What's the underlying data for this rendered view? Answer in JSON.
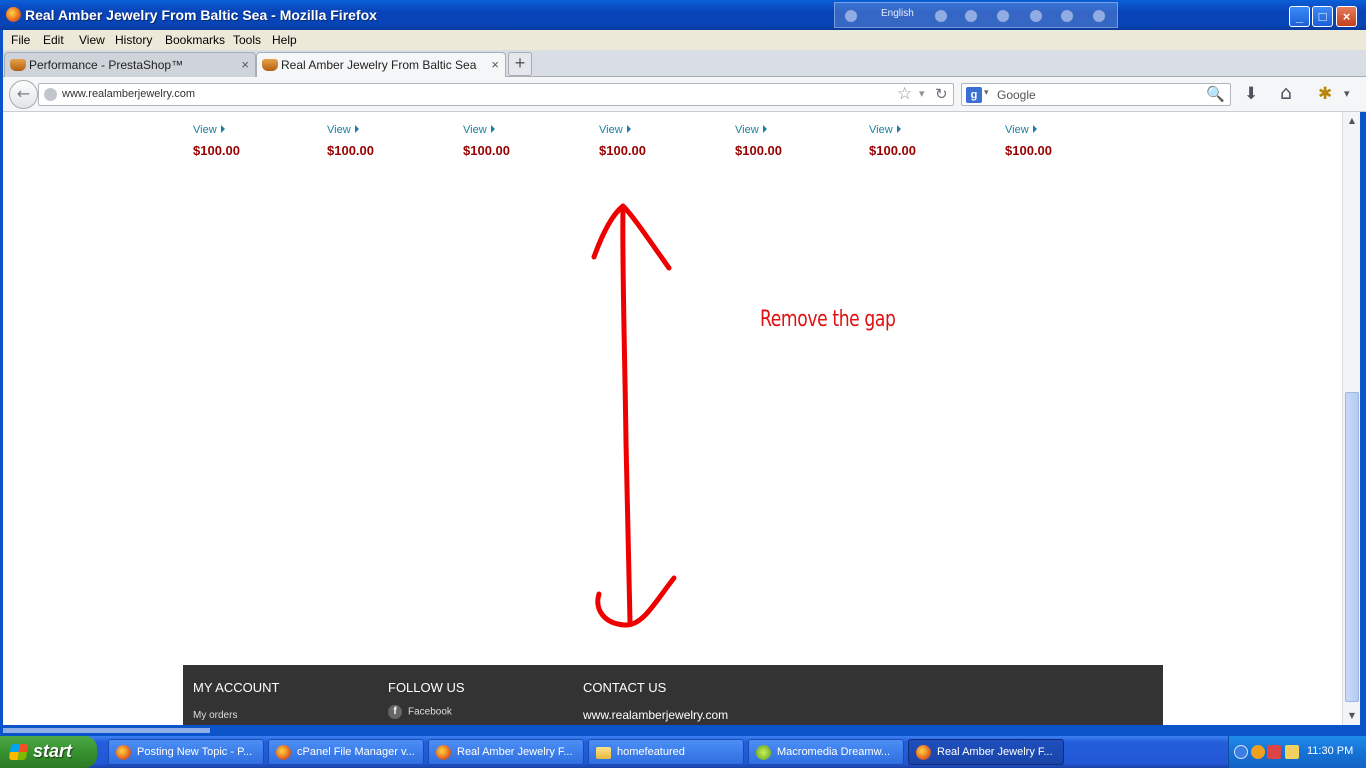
{
  "window": {
    "title": "Real Amber Jewelry From Baltic Sea - Mozilla Firefox",
    "language": "English",
    "minimize": "_",
    "maximize": "□",
    "close": "×"
  },
  "menu": [
    "File",
    "Edit",
    "View",
    "History",
    "Bookmarks",
    "Tools",
    "Help"
  ],
  "tabs": [
    {
      "label": "Performance - PrestaShop™",
      "close": "×"
    },
    {
      "label": "Real Amber Jewelry From Baltic Sea",
      "close": "×"
    }
  ],
  "new_tab": "+",
  "nav": {
    "back": "←",
    "url": "www.realamberjewelry.com",
    "star": "☆",
    "dropdown": "▾",
    "reload": "↻",
    "search_engine": "g",
    "search_dropdown": "▾",
    "search_placeholder": "Google",
    "search_icon": "🔍",
    "download": "⬇",
    "home": "⌂",
    "addon": "✱",
    "menu_arrow": "▾"
  },
  "products": [
    {
      "view": "View",
      "price": "$100.00"
    },
    {
      "view": "View",
      "price": "$100.00"
    },
    {
      "view": "View",
      "price": "$100.00"
    },
    {
      "view": "View",
      "price": "$100.00"
    },
    {
      "view": "View",
      "price": "$100.00"
    },
    {
      "view": "View",
      "price": "$100.00"
    },
    {
      "view": "View",
      "price": "$100.00"
    }
  ],
  "annotation": "Remove the gap",
  "footer": {
    "my_account": {
      "heading": "MY ACCOUNT",
      "link": "My orders"
    },
    "follow_us": {
      "heading": "FOLLOW US",
      "link": "Facebook",
      "icon": "f"
    },
    "contact_us": {
      "heading": "CONTACT US",
      "url": "www.realamberjewelry.com"
    }
  },
  "scrollbar": {
    "up": "▲",
    "down": "▼"
  },
  "taskbar": {
    "start": "start",
    "tasks": [
      "Posting New Topic - P...",
      "cPanel File Manager v...",
      "Real Amber Jewelry F...",
      "homefeatured",
      "Macromedia Dreamw...",
      "Real Amber Jewelry F..."
    ],
    "clock": "11:30 PM"
  }
}
